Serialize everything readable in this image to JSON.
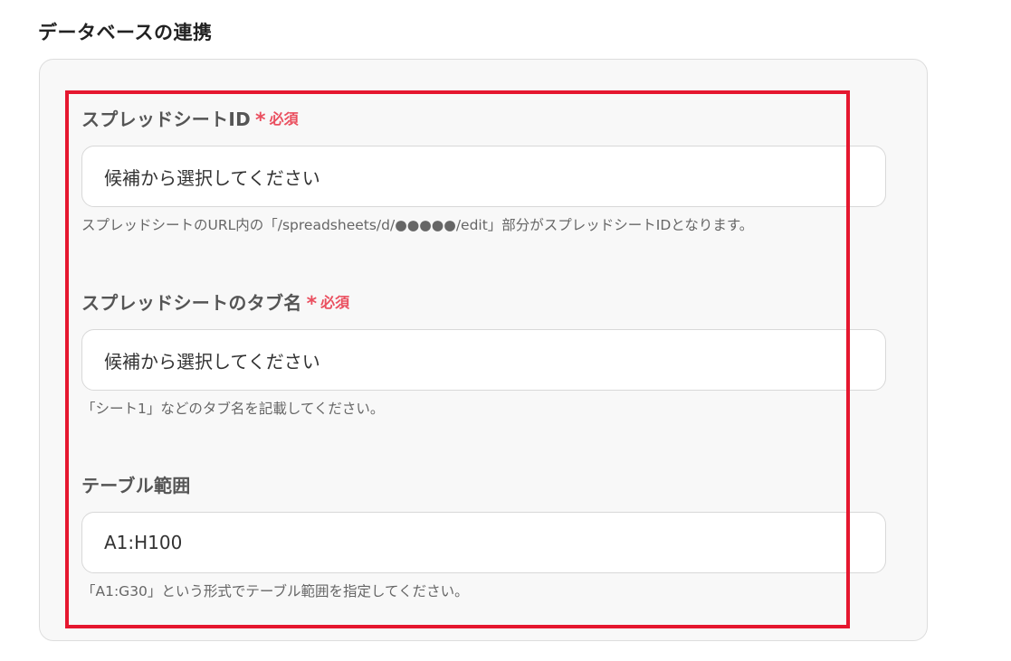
{
  "section": {
    "title": "データベースの連携"
  },
  "fields": [
    {
      "label": "スプレッドシートID",
      "required_mark": "*",
      "required_text": "必須",
      "value": "候補から選択してください",
      "hint": "スプレッドシートのURL内の「/spreadsheets/d/●●●●●/edit」部分がスプレッドシートIDとなります。"
    },
    {
      "label": "スプレッドシートのタブ名",
      "required_mark": "*",
      "required_text": "必須",
      "value": "候補から選択してください",
      "hint": "「シート1」などのタブ名を記載してください。"
    },
    {
      "label": "テーブル範囲",
      "value": "A1:H100",
      "hint": "「A1:G30」という形式でテーブル範囲を指定してください。"
    }
  ],
  "colors": {
    "required": "#ea4f5f",
    "highlight_border": "#e5172f",
    "card_background": "#f8f8f8"
  }
}
